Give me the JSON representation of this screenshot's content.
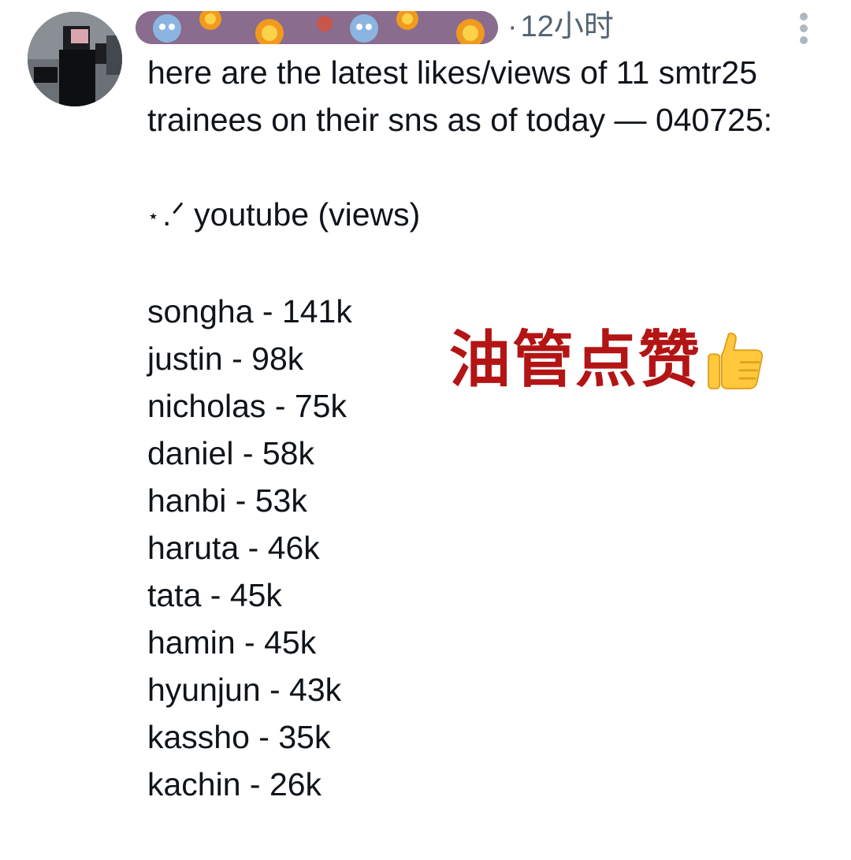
{
  "post": {
    "timestamp": "12小时",
    "timestamp_dot": "·",
    "text_intro": "here are the latest likes/views of 11 smtr25 trainees on their sns as of today — 040725:",
    "section_star": "⋆",
    "section_heading": ".ᐟ youtube (views)",
    "stats": [
      "songha - 141k",
      "justin - 98k",
      "nicholas - 75k",
      "daniel - 58k",
      "hanbi - 53k",
      "haruta - 46k",
      "tata - 45k",
      "hamin - 45k",
      "hyunjun - 43k",
      "kassho - 35k",
      "kachin - 26k"
    ]
  },
  "overlay": {
    "caption": "油管点赞",
    "emoji_icon": "thumbs-up-icon"
  },
  "colors": {
    "text": "#0f1419",
    "muted": "#536471",
    "caption_red": "#b31414"
  }
}
